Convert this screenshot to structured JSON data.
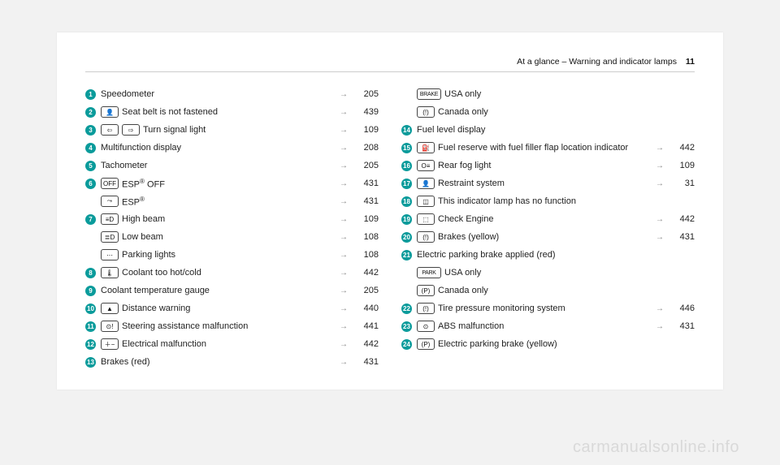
{
  "header": {
    "title": "At a glance – Warning and indicator lamps",
    "page": "11"
  },
  "watermark": "carmanualsonline.info",
  "left": [
    {
      "n": "1",
      "syms": [],
      "label": "Speedometer",
      "ref": "205"
    },
    {
      "n": "2",
      "syms": [
        "👤"
      ],
      "label": "Seat belt is not fastened",
      "ref": "439"
    },
    {
      "n": "3",
      "syms": [
        "⇦",
        "⇨"
      ],
      "label": "Turn signal light",
      "ref": "109"
    },
    {
      "n": "4",
      "syms": [],
      "label": "Multifunction display",
      "ref": "208"
    },
    {
      "n": "5",
      "syms": [],
      "label": "Tachometer",
      "ref": "205"
    },
    {
      "n": "6",
      "syms": [
        "OFF"
      ],
      "label": "ESP® OFF",
      "ref": "431"
    },
    {
      "n": "",
      "syms": [
        "⤳"
      ],
      "label": "ESP®",
      "ref": "431"
    },
    {
      "n": "7",
      "syms": [
        "≡D"
      ],
      "label": "High beam",
      "ref": "109"
    },
    {
      "n": "",
      "syms": [
        "≣D"
      ],
      "label": "Low beam",
      "ref": "108"
    },
    {
      "n": "",
      "syms": [
        "⋯"
      ],
      "label": "Parking lights",
      "ref": "108"
    },
    {
      "n": "8",
      "syms": [
        "🌡"
      ],
      "label": "Coolant too hot/cold",
      "ref": "442"
    },
    {
      "n": "9",
      "syms": [],
      "label": "Coolant temperature gauge",
      "ref": "205"
    },
    {
      "n": "10",
      "syms": [
        "▲"
      ],
      "label": "Distance warning",
      "ref": "440"
    },
    {
      "n": "11",
      "syms": [
        "⊙!"
      ],
      "label": "Steering assistance malfunction",
      "ref": "441"
    },
    {
      "n": "12",
      "syms": [
        "＋−"
      ],
      "label": "Electrical malfunction",
      "ref": "442"
    },
    {
      "n": "13",
      "syms": [],
      "label": "Brakes (red)",
      "ref": "431"
    }
  ],
  "right": [
    {
      "n": "",
      "syms": [
        "BRAKE"
      ],
      "wide": true,
      "label": "USA only",
      "ref": ""
    },
    {
      "n": "",
      "syms": [
        "(!)"
      ],
      "label": "Canada only",
      "ref": ""
    },
    {
      "n": "14",
      "syms": [],
      "label": "Fuel level display",
      "ref": ""
    },
    {
      "n": "15",
      "syms": [
        "⛽"
      ],
      "label": "Fuel reserve with fuel filler flap location indicator",
      "ref": "442"
    },
    {
      "n": "16",
      "syms": [
        "O≡"
      ],
      "label": "Rear fog light",
      "ref": "109"
    },
    {
      "n": "17",
      "syms": [
        "👤"
      ],
      "label": "Restraint system",
      "ref": "31"
    },
    {
      "n": "18",
      "syms": [
        "◫"
      ],
      "label": "This indicator lamp has no function",
      "ref": ""
    },
    {
      "n": "19",
      "syms": [
        "⬚"
      ],
      "label": "Check Engine",
      "ref": "442"
    },
    {
      "n": "20",
      "syms": [
        "(!)"
      ],
      "label": "Brakes (yellow)",
      "ref": "431"
    },
    {
      "n": "21",
      "syms": [],
      "label": "Electric parking brake applied (red)",
      "ref": ""
    },
    {
      "n": "",
      "syms": [
        "PARK"
      ],
      "wide": true,
      "label": "USA only",
      "ref": ""
    },
    {
      "n": "",
      "syms": [
        "(P)"
      ],
      "label": "Canada only",
      "ref": ""
    },
    {
      "n": "22",
      "syms": [
        "(!)"
      ],
      "label": "Tire pressure monitoring system",
      "ref": "446"
    },
    {
      "n": "23",
      "syms": [
        "⊙"
      ],
      "label": "ABS malfunction",
      "ref": "431"
    },
    {
      "n": "24",
      "syms": [
        "(P)"
      ],
      "label": "Electric parking brake (yellow)",
      "ref": ""
    }
  ]
}
